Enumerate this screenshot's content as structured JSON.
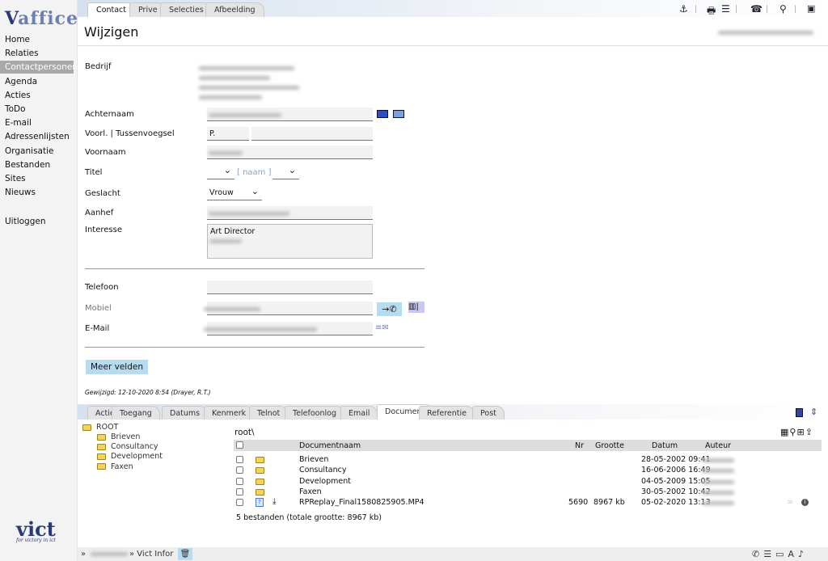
{
  "sidebar": {
    "logo": "vaffice",
    "items": [
      "Home",
      "Relaties",
      "Contactpersonen",
      "Agenda",
      "Acties",
      "ToDo",
      "E-mail",
      "Adressenlijsten",
      "Organisatie",
      "Bestanden",
      "Sites",
      "Nieuws"
    ],
    "active": "Contactpersonen",
    "logout": "Uitloggen",
    "footer_logo": "vict",
    "footer_tagline": "for victory in ict"
  },
  "top_tabs": [
    "Contact",
    "Prive",
    "Selecties",
    "Afbeelding"
  ],
  "toolbar_icons": [
    "anchor-icon",
    "printer-icon",
    "list-icon",
    "phone-icon",
    "search-icon",
    "save-icon"
  ],
  "title": "Wijzigen",
  "form": {
    "bedrijf_label": "Bedrijf",
    "achternaam_label": "Achternaam",
    "voorl_label": "Voorl. | Tussenvoegsel",
    "voorl_value": "P.",
    "voornaam_label": "Voornaam",
    "titel_label": "Titel",
    "naam_link": "[ naam ]",
    "geslacht_label": "Geslacht",
    "geslacht_value": "Vrouw",
    "aanhef_label": "Aanhef",
    "interesse_label": "Interesse",
    "interesse_value": "Art Director",
    "telefoon_label": "Telefoon",
    "mobiel_label": "Mobiel",
    "email_label": "E-Mail",
    "meer_velden": "Meer velden",
    "gewijzigd": "Gewijzigd: 12-10-2020 8:54 (Drayer, R.T.)"
  },
  "bottom_tabs": [
    "Actie",
    "Toegang",
    "Datums",
    "Kenmerk",
    "Telnot",
    "Telefoonlog",
    "Email",
    "Document",
    "Referentie",
    "Post"
  ],
  "active_bottom_tab": "Document",
  "tree": {
    "root": "ROOT",
    "children": [
      "Brieven",
      "Consultancy",
      "Development",
      "Faxen"
    ]
  },
  "documents": {
    "path": "root\\",
    "columns": [
      "Documentnaam",
      "Nr",
      "Grootte",
      "Datum",
      "Auteur"
    ],
    "rows": [
      {
        "name": "Brieven",
        "nr": "",
        "size": "",
        "date": "28-05-2002 09:41",
        "type": "folder"
      },
      {
        "name": "Consultancy",
        "nr": "",
        "size": "",
        "date": "16-06-2006 16:49",
        "type": "folder"
      },
      {
        "name": "Development",
        "nr": "",
        "size": "",
        "date": "04-05-2009 15:05",
        "type": "folder"
      },
      {
        "name": "Faxen",
        "nr": "",
        "size": "",
        "date": "30-05-2002 10:42",
        "type": "folder"
      },
      {
        "name": "RPReplay_Final1580825905.MP4",
        "nr": "5690",
        "size": "8967 kb",
        "date": "05-02-2020 13:13",
        "type": "file"
      }
    ],
    "summary": "5 bestanden (totale grootte: 8967 kb)"
  },
  "footer": {
    "breadcrumb_sep": "»",
    "company": "» Vict Infor"
  }
}
